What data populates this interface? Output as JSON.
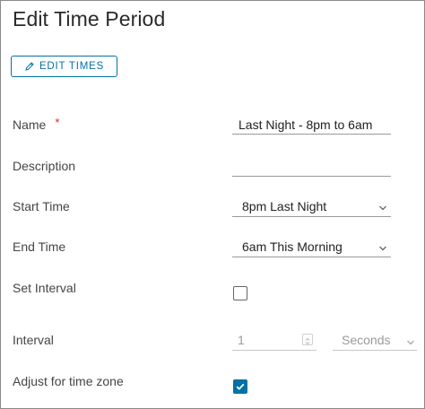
{
  "dialog": {
    "title": "Edit Time Period",
    "edit_times_label": "EDIT TIMES"
  },
  "colors": {
    "accent": "#0072a3",
    "required": "#e02020",
    "border": "#8a8a8a",
    "disabled_text": "#9a9a9a"
  },
  "fields": {
    "name": {
      "label": "Name",
      "required_mark": "*",
      "value": "Last Night - 8pm to 6am"
    },
    "description": {
      "label": "Description",
      "value": ""
    },
    "start_time": {
      "label": "Start Time",
      "selected": "8pm Last Night"
    },
    "end_time": {
      "label": "End Time",
      "selected": "6am This Morning"
    },
    "set_interval": {
      "label": "Set Interval",
      "checked": false
    },
    "interval": {
      "label": "Interval",
      "value": "1",
      "unit": "Seconds",
      "disabled": true
    },
    "adjust_time_zone": {
      "label": "Adjust for time zone",
      "checked": true
    }
  },
  "icons": {
    "edit": "pencil-icon",
    "dropdown": "chevron-down-icon",
    "spinner": "spinner-icon",
    "check": "checkmark-icon"
  }
}
